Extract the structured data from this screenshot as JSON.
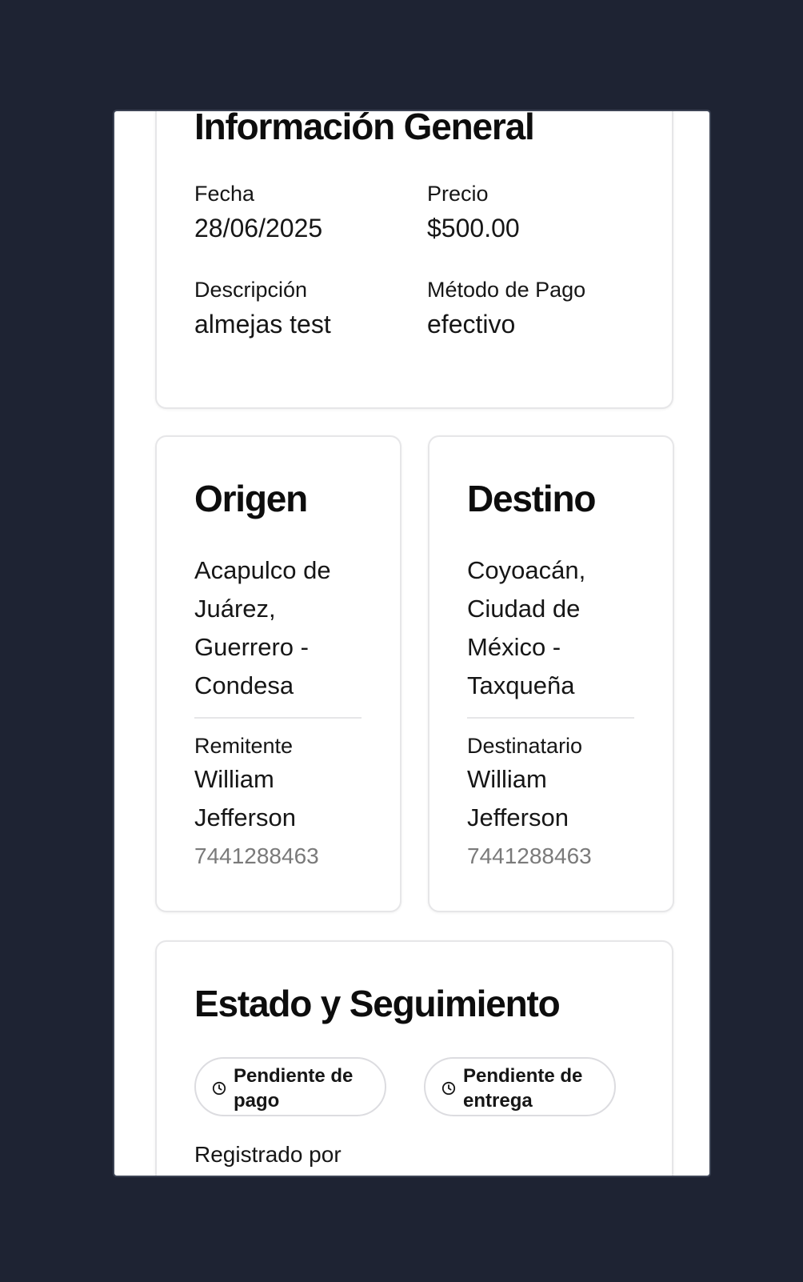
{
  "general": {
    "title": "Información General",
    "fecha_label": "Fecha",
    "fecha_value": "28/06/2025",
    "precio_label": "Precio",
    "precio_value": "$500.00",
    "descripcion_label": "Descripción",
    "descripcion_value": "almejas test",
    "metodo_label": "Método de Pago",
    "metodo_value": "efectivo"
  },
  "origen": {
    "title": "Origen",
    "address": "Acapulco de Juárez, Guerrero - Condesa",
    "person_label": "Remitente",
    "person_name": "William Jefferson",
    "phone": "7441288463"
  },
  "destino": {
    "title": "Destino",
    "address": "Coyoacán, Ciudad de México - Taxqueña",
    "person_label": "Destinatario",
    "person_name": "William Jefferson",
    "phone": "7441288463"
  },
  "estado": {
    "title": "Estado y Seguimiento",
    "badges": [
      {
        "label": "Pendiente de pago",
        "icon": "clock-icon"
      },
      {
        "label": "Pendiente de entrega",
        "icon": "clock-icon"
      }
    ],
    "registrado_label": "Registrado por"
  },
  "colors": {
    "background": "#1e2333",
    "panel": "#ffffff",
    "card_border": "#e6e6e8",
    "muted_text": "#7a7a7a"
  }
}
